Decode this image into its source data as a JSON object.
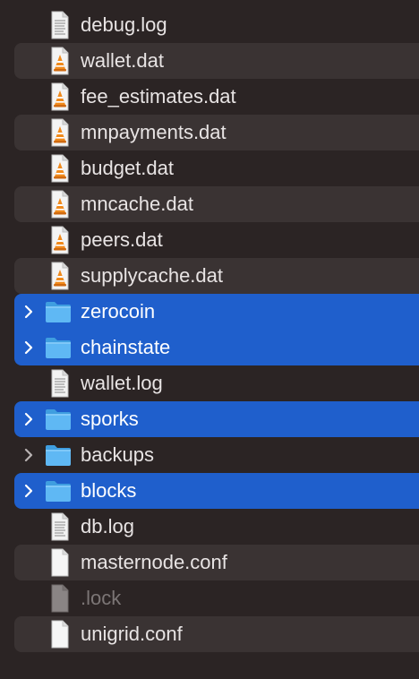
{
  "files": [
    {
      "name": "debug.log",
      "icon": "text-file-icon",
      "striped": false,
      "selected": false,
      "folder": false
    },
    {
      "name": "wallet.dat",
      "icon": "vlc-file-icon",
      "striped": true,
      "selected": false,
      "folder": false
    },
    {
      "name": "fee_estimates.dat",
      "icon": "vlc-file-icon",
      "striped": false,
      "selected": false,
      "folder": false
    },
    {
      "name": "mnpayments.dat",
      "icon": "vlc-file-icon",
      "striped": true,
      "selected": false,
      "folder": false
    },
    {
      "name": "budget.dat",
      "icon": "vlc-file-icon",
      "striped": false,
      "selected": false,
      "folder": false
    },
    {
      "name": "mncache.dat",
      "icon": "vlc-file-icon",
      "striped": true,
      "selected": false,
      "folder": false
    },
    {
      "name": "peers.dat",
      "icon": "vlc-file-icon",
      "striped": false,
      "selected": false,
      "folder": false
    },
    {
      "name": "supplycache.dat",
      "icon": "vlc-file-icon",
      "striped": true,
      "selected": false,
      "folder": false
    },
    {
      "name": "zerocoin",
      "icon": "folder-icon",
      "striped": false,
      "selected": true,
      "folder": true
    },
    {
      "name": "chainstate",
      "icon": "folder-icon",
      "striped": true,
      "selected": true,
      "folder": true
    },
    {
      "name": "wallet.log",
      "icon": "text-file-icon",
      "striped": false,
      "selected": false,
      "folder": false
    },
    {
      "name": "sporks",
      "icon": "folder-icon",
      "striped": true,
      "selected": true,
      "folder": true
    },
    {
      "name": "backups",
      "icon": "folder-icon",
      "striped": false,
      "selected": false,
      "folder": true
    },
    {
      "name": "blocks",
      "icon": "folder-icon",
      "striped": true,
      "selected": true,
      "folder": true
    },
    {
      "name": "db.log",
      "icon": "text-file-icon",
      "striped": false,
      "selected": false,
      "folder": false
    },
    {
      "name": "masternode.conf",
      "icon": "blank-file-icon",
      "striped": true,
      "selected": false,
      "folder": false
    },
    {
      "name": ".lock",
      "icon": "locked-file-icon",
      "striped": false,
      "selected": false,
      "folder": false,
      "dim": true
    },
    {
      "name": "unigrid.conf",
      "icon": "blank-file-icon",
      "striped": true,
      "selected": false,
      "folder": false
    }
  ],
  "colors": {
    "background": "#2b2424",
    "stripe": "#3a3333",
    "selection": "#1f5fcc",
    "folder": "#4fb0f0",
    "vlc_cone": "#f08a1c"
  }
}
